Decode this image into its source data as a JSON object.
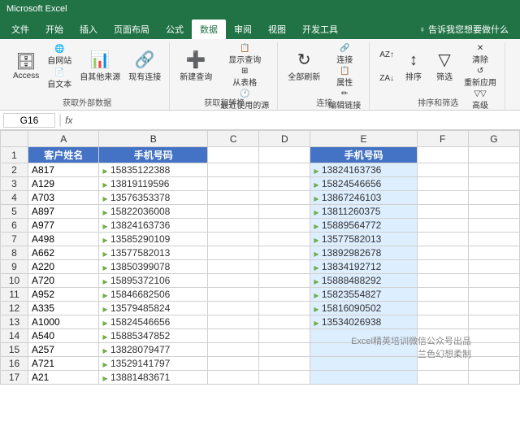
{
  "titleBar": {
    "title": "Microsoft Excel"
  },
  "ribbonTabs": [
    {
      "label": "文件",
      "active": false
    },
    {
      "label": "开始",
      "active": false
    },
    {
      "label": "插入",
      "active": false
    },
    {
      "label": "页面布局",
      "active": false
    },
    {
      "label": "公式",
      "active": false
    },
    {
      "label": "数据",
      "active": true
    },
    {
      "label": "审阅",
      "active": false
    },
    {
      "label": "视图",
      "active": false
    },
    {
      "label": "开发工具",
      "active": false
    }
  ],
  "helpText": "♀ 告诉我您想要做什么",
  "groups": {
    "getExternal": {
      "label": "获取外部数据",
      "buttons": [
        {
          "id": "access",
          "icon": "🗄",
          "label": "Access"
        },
        {
          "id": "web",
          "icon": "🌐",
          "label": "自网站"
        },
        {
          "id": "text",
          "icon": "📄",
          "label": "自文本"
        },
        {
          "id": "other",
          "icon": "📊",
          "label": "自其他来源"
        },
        {
          "id": "existing",
          "icon": "🔗",
          "label": "现有连接"
        }
      ]
    },
    "getTransform": {
      "label": "获取和转换",
      "buttons": [
        {
          "id": "newQuery",
          "icon": "➕",
          "label": "新建查询"
        },
        {
          "id": "showQuery",
          "icon": "👁",
          "label": "显示查询"
        },
        {
          "id": "fromTable",
          "icon": "⊞",
          "label": "从表格"
        },
        {
          "id": "recent",
          "icon": "🕐",
          "label": "最近使用的源"
        }
      ]
    },
    "connections": {
      "label": "连接",
      "buttons": [
        {
          "id": "refreshAll",
          "icon": "↻",
          "label": "全部刷新"
        },
        {
          "id": "connections",
          "icon": "🔗",
          "label": "连接"
        },
        {
          "id": "properties",
          "icon": "📋",
          "label": "属性"
        },
        {
          "id": "editLinks",
          "icon": "✏",
          "label": "编辑链接"
        }
      ]
    },
    "sort": {
      "label": "排序和筛选",
      "buttons": [
        {
          "id": "sortAZ",
          "icon": "↑↓",
          "label": "排序"
        },
        {
          "id": "filter",
          "icon": "▽",
          "label": "筛选"
        },
        {
          "id": "advanced",
          "icon": "▽▽",
          "label": "高级"
        },
        {
          "id": "clear",
          "icon": "✕",
          "label": "清除"
        },
        {
          "id": "reapply",
          "icon": "↺",
          "label": "重新应用"
        }
      ]
    }
  },
  "formulaBar": {
    "nameBox": "G16",
    "formula": ""
  },
  "columnHeaders": [
    "",
    "A",
    "B",
    "C",
    "D",
    "E",
    "F",
    "G"
  ],
  "tableHeaders": {
    "colA": "客户姓名",
    "colB": "手机号码",
    "colE": "手机号码"
  },
  "rows": [
    {
      "rowNum": "2",
      "a": "A817",
      "b": "15835122388",
      "e": "13824163736"
    },
    {
      "rowNum": "3",
      "a": "A129",
      "b": "13819119596",
      "e": "15824546656"
    },
    {
      "rowNum": "4",
      "a": "A703",
      "b": "13576353378",
      "e": "13867246103"
    },
    {
      "rowNum": "5",
      "a": "A897",
      "b": "15822036008",
      "e": "13811260375"
    },
    {
      "rowNum": "6",
      "a": "A977",
      "b": "13824163736",
      "e": "15889564772"
    },
    {
      "rowNum": "7",
      "a": "A498",
      "b": "13585290109",
      "e": "13577582013"
    },
    {
      "rowNum": "8",
      "a": "A662",
      "b": "13577582013",
      "e": "13892982678"
    },
    {
      "rowNum": "9",
      "a": "A220",
      "b": "13850399078",
      "e": "13834192712"
    },
    {
      "rowNum": "10",
      "a": "A720",
      "b": "15895372106",
      "e": "15888488292"
    },
    {
      "rowNum": "11",
      "a": "A952",
      "b": "15846682506",
      "e": "15823554827"
    },
    {
      "rowNum": "12",
      "a": "A335",
      "b": "13579485824",
      "e": "15816090502"
    },
    {
      "rowNum": "13",
      "a": "A1000",
      "b": "15824546656",
      "e": "13534026938"
    },
    {
      "rowNum": "14",
      "a": "A540",
      "b": "15885347852",
      "e": ""
    },
    {
      "rowNum": "15",
      "a": "A257",
      "b": "13828079477",
      "e": ""
    },
    {
      "rowNum": "16",
      "a": "A721",
      "b": "13529141797",
      "e": ""
    },
    {
      "rowNum": "17",
      "a": "A21",
      "b": "13881483671",
      "e": ""
    }
  ],
  "watermark": {
    "line1": "Excel精英培训微信公众号出品",
    "line2": "兰色幻想柔制"
  },
  "colors": {
    "ribbonGreen": "#217346",
    "headerBlue": "#4472C4",
    "highlightBlue": "#DDEEFF",
    "greenDot": "#70AD47"
  }
}
